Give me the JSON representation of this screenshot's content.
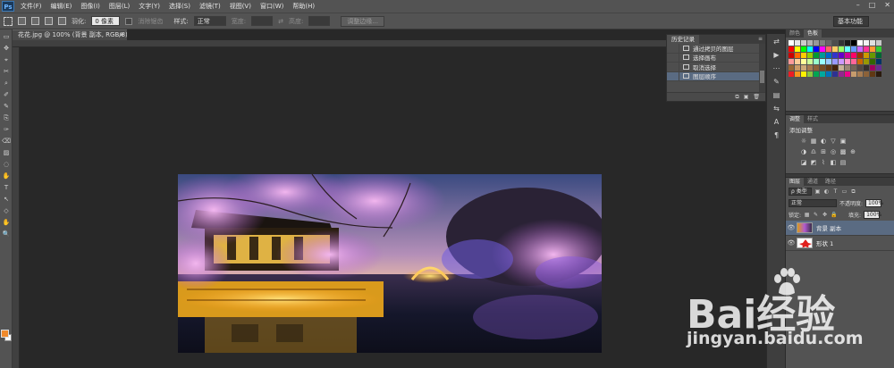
{
  "app": {
    "logo": "Ps"
  },
  "menu": [
    "文件(F)",
    "编辑(E)",
    "图像(I)",
    "图层(L)",
    "文字(Y)",
    "选择(S)",
    "滤镜(T)",
    "视图(V)",
    "窗口(W)",
    "帮助(H)"
  ],
  "window_controls": {
    "minimize": "–",
    "restore": "□",
    "close": "✕"
  },
  "options": {
    "feather_label": "羽化:",
    "feather_value": "0 像素",
    "antialias_label": "消除锯齿",
    "style_label": "样式:",
    "style_value": "正常",
    "width_label": "宽度:",
    "height_label": "高度:",
    "refine_edge": "调整边缘...",
    "workspace": "基本功能"
  },
  "document_tab": {
    "title": "花花.jpg @ 100% (背景 副本, RGB/8) *",
    "close": "×"
  },
  "history": {
    "tab": "历史记录",
    "items": [
      {
        "label": "通过拷贝的图层",
        "active": false
      },
      {
        "label": "选择画布",
        "active": false
      },
      {
        "label": "取消选择",
        "active": false
      },
      {
        "label": "图层顺序",
        "active": true
      }
    ]
  },
  "swatches_panel": {
    "tabs": [
      "颜色",
      "色板"
    ],
    "colors": [
      "#ffffff",
      "#e6e6e6",
      "#cccccc",
      "#b3b3b3",
      "#999999",
      "#808080",
      "#666666",
      "#4d4d4d",
      "#333333",
      "#1a1a1a",
      "#000000",
      "#ffffff",
      "#f2f2f2",
      "#e0e0e0",
      "#c8c8c8",
      "#ff0000",
      "#ffff00",
      "#00ff00",
      "#00ffff",
      "#0000ff",
      "#ff00ff",
      "#ff6666",
      "#ffcc66",
      "#99ff66",
      "#66ffff",
      "#6699ff",
      "#cc66ff",
      "#ff3399",
      "#ff9933",
      "#33cc33",
      "#cc0000",
      "#ff6600",
      "#ffcc00",
      "#99cc00",
      "#009933",
      "#009999",
      "#0066cc",
      "#3333cc",
      "#6600cc",
      "#cc0099",
      "#ff0066",
      "#993300",
      "#cc9900",
      "#669900",
      "#006633",
      "#ff9999",
      "#ffcc99",
      "#ffff99",
      "#ccff99",
      "#99ffcc",
      "#99ffff",
      "#99ccff",
      "#9999ff",
      "#cc99ff",
      "#ff99cc",
      "#ff6699",
      "#cc6600",
      "#999900",
      "#336600",
      "#003366",
      "#996633",
      "#cc9966",
      "#ccaa77",
      "#a67c52",
      "#8c6239",
      "#754c24",
      "#603813",
      "#42210b",
      "#c7b299",
      "#998675",
      "#736357",
      "#534741",
      "#362f2d",
      "#9e005d",
      "#662d91",
      "#ed1c24",
      "#f7941d",
      "#fff200",
      "#8dc63f",
      "#00a651",
      "#00a99d",
      "#0072bc",
      "#2e3192",
      "#92278f",
      "#ec008c",
      "#c69c6d",
      "#a67c52",
      "#8c6239",
      "#603813",
      "#2b1b0e"
    ]
  },
  "adjustments": {
    "tabs": [
      "调整",
      "样式"
    ],
    "title": "添加调整",
    "row1": [
      "☼",
      "▦",
      "◐",
      "▽",
      "▣"
    ],
    "row2": [
      "◑",
      "♎",
      "⊞",
      "◎",
      "▩",
      "⊕"
    ],
    "row3": [
      "◪",
      "◩",
      "⌇",
      "◧",
      "▤"
    ]
  },
  "layers": {
    "tabs": [
      "图层",
      "通道",
      "路径"
    ],
    "kind_label": "ρ 类型",
    "blend_mode": "正常",
    "opacity_label": "不透明度:",
    "opacity_value": "100%",
    "lock_label": "锁定:",
    "fill_label": "填充:",
    "fill_value": "100%",
    "items": [
      {
        "name": "背景 副本",
        "selected": true
      },
      {
        "name": "形状 1",
        "selected": false
      }
    ]
  },
  "watermark": {
    "brand": "Bai经验",
    "url": "jingyan.baidu.com"
  },
  "icons": {
    "eye": "👁",
    "panel_menu": "≡",
    "dock": [
      "⇄",
      "▶",
      "⋯",
      "✎",
      "▤",
      "⇆",
      "A",
      "¶"
    ],
    "history_footer": [
      "⧉",
      "▣",
      "🗑"
    ],
    "tools": [
      "▭",
      "✥",
      "⌖",
      "✂",
      "⌕",
      "✐",
      "✎",
      "⎘",
      "✑",
      "⌫",
      "▨",
      "◌",
      "✋",
      "T",
      "↖",
      "◇",
      "✋",
      "🔍"
    ]
  }
}
